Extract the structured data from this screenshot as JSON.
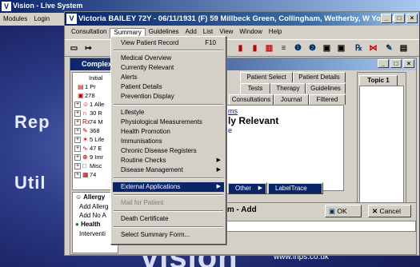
{
  "background_app": {
    "title": "Vision - Live System",
    "menu": [
      "Modules",
      "Login"
    ],
    "big_texts": {
      "rep": "Rep",
      "util": "Util",
      "vision": "vision"
    },
    "url": "www.inps.co.uk"
  },
  "window": {
    "title": "Victoria BAILEY 72Y - 06/11/1931 (F) 59 Millbeck Green, Collingham, Wetherby, W Yorkshi...",
    "buttons": {
      "minimize": "_",
      "maximize": "□",
      "close": "×"
    }
  },
  "menubar": [
    "Consultation",
    "Summary",
    "Guidelines",
    "Add",
    "List",
    "View",
    "Window",
    "Help"
  ],
  "active_menu": "Summary",
  "child_window": {
    "title": "Complex"
  },
  "tree": [
    {
      "text": "Initial",
      "expander": "",
      "icon": ""
    },
    {
      "text": "1 Pr",
      "expander": "",
      "icon": "▤"
    },
    {
      "text": "278",
      "expander": "",
      "icon": "▣"
    },
    {
      "text": "1 Alle",
      "expander": "+",
      "icon": "☺"
    },
    {
      "text": "30 R",
      "expander": "+",
      "icon": "∩"
    },
    {
      "text": "74 M",
      "expander": "+",
      "icon": "Rx"
    },
    {
      "text": "368",
      "expander": "+",
      "icon": "✎"
    },
    {
      "text": "5 Life",
      "expander": "+",
      "icon": "☀"
    },
    {
      "text": "47 E",
      "expander": "+",
      "icon": "∿"
    },
    {
      "text": "9 Imr",
      "expander": "+",
      "icon": "⊕"
    },
    {
      "text": "Misc",
      "expander": "+",
      "icon": "□"
    },
    {
      "text": "74",
      "expander": "+",
      "icon": "▦"
    }
  ],
  "lower_pane": {
    "header": "Allergy",
    "rows": [
      "Add Allerg",
      "Add No A"
    ],
    "health": "Health",
    "intervention": "Interventi"
  },
  "tabs_row1": [
    "Patient Select",
    "Patient Details"
  ],
  "tabs_row2": [
    "Tests",
    "Therapy",
    "Guidelines"
  ],
  "tabs_row3": [
    "Consultations",
    "Journal",
    "Filtered"
  ],
  "content": {
    "link": "ms",
    "heading": "ly Relevant",
    "sub": "e"
  },
  "topic": {
    "tab": "Topic 1"
  },
  "form": {
    "title": "rm - Add",
    "ok": "OK",
    "cancel": "Cancel"
  },
  "dropdown": {
    "items": [
      {
        "label": "View Patient Record",
        "shortcut": "F10"
      },
      {
        "label": "Medical Overview"
      },
      {
        "label": "Currently Relevant"
      },
      {
        "label": "Alerts"
      },
      {
        "label": "Patient Details"
      },
      {
        "label": "Prevention Display"
      },
      {
        "label": "Lifestyle"
      },
      {
        "label": "Physiological Measurements"
      },
      {
        "label": "Health Promotion"
      },
      {
        "label": "Immunisations"
      },
      {
        "label": "Chronic Disease Registers"
      },
      {
        "label": "Routine Checks"
      },
      {
        "label": "Disease Management"
      },
      {
        "label": "External Applications"
      },
      {
        "label": "Mail for Patient"
      },
      {
        "label": "Death Certificate"
      },
      {
        "label": "Select Summary Form..."
      }
    ]
  },
  "submenu1": {
    "label": "Other"
  },
  "submenu2": {
    "label": "LabelTrace"
  },
  "colors": {
    "highlight": "#0a246a",
    "face": "#d4d0c8",
    "link": "#0000ff"
  }
}
